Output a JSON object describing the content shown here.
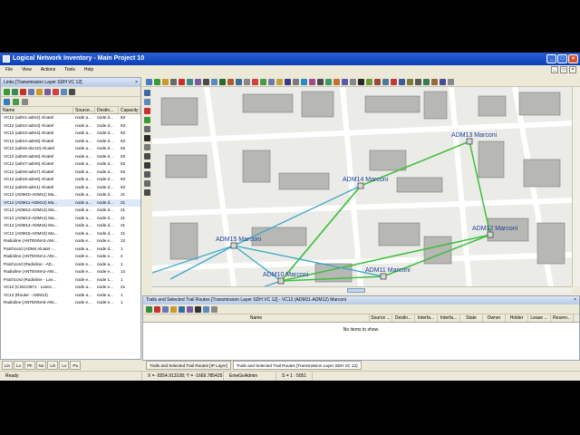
{
  "window": {
    "title": "Logical Network Inventory - Main Project 10"
  },
  "menu": [
    "File",
    "View",
    "Actions",
    "Tools",
    "Help"
  ],
  "links_panel": {
    "title": "Links [Transmission Layer SDH VC 12]",
    "columns": [
      "Name",
      "Source...",
      "Destin...",
      "Capacity"
    ],
    "rows": [
      [
        "VC12 (adm1-adm2) Alcatel",
        "node a...",
        "node d...",
        "63"
      ],
      [
        "VC12 (adm2-adm3) Alcatel",
        "node a...",
        "node d...",
        "63"
      ],
      [
        "VC12 (adm3-adm4) Alcatel",
        "node a...",
        "node d...",
        "63"
      ],
      [
        "VC12 (adm4-adm5) Alcatel",
        "node a...",
        "node d...",
        "63"
      ],
      [
        "VC12 (adm5-dxc10) Alcatel",
        "node a...",
        "node d...",
        "63"
      ],
      [
        "VC12 (adm5-adm6) Alcatel",
        "node a...",
        "node d...",
        "63"
      ],
      [
        "VC12 (adm7-adm6) Alcatel",
        "node a...",
        "node d...",
        "63"
      ],
      [
        "VC12 (adm8-adm7) Alcatel",
        "node a...",
        "node d...",
        "63"
      ],
      [
        "VC12 (adm9-adm8) Alcatel",
        "node a...",
        "node d...",
        "63"
      ],
      [
        "VC12 (adm9-adm1) Alcatel",
        "node a...",
        "node d...",
        "63"
      ],
      [
        "VC12 (ADM10-ADM11) Ma...",
        "node a...",
        "node d...",
        "21"
      ],
      [
        "VC12 (ADM11-ADM12) Ma...",
        "node a...",
        "node d...",
        "21"
      ],
      [
        "VC12 (ADM12-ADM13) Ma...",
        "node a...",
        "node d...",
        "21"
      ],
      [
        "VC12 (ADM13-ADM14) Ma...",
        "node a...",
        "node d...",
        "21"
      ],
      [
        "VC12 (ADM14-ADM15) Ma...",
        "node a...",
        "node d...",
        "21"
      ],
      [
        "VC12 (ADM15-ADM10) Ma...",
        "node a...",
        "node d...",
        "21"
      ],
      [
        "Radioline (ANTENNA3-ANI...",
        "node e...",
        "node e...",
        "12"
      ],
      [
        "Patchcord (ADM4 Alcatel -...",
        "node a...",
        "node d...",
        "1"
      ],
      [
        "Radioline (ANTENNA1-ANI...",
        "node e...",
        "node e...",
        "2"
      ],
      [
        "Patchcord (Radioline - AD...",
        "node e...",
        "node a...",
        "1"
      ],
      [
        "Radioline (ANTENNA2-ANI...",
        "node e...",
        "node e...",
        "12"
      ],
      [
        "Patchcord (Radioline - Lan...",
        "node e...",
        "node 1...",
        "1"
      ],
      [
        "VC12 (CISCO871 - Lanec...",
        "node a...",
        "node e...",
        "21"
      ],
      [
        "VC12 (Router - ADM13)",
        "node a...",
        "node a...",
        "1"
      ],
      [
        "Radioline (ANTENNA6-ANI...",
        "node e...",
        "node e...",
        "1"
      ]
    ],
    "tabs": [
      "Lin",
      "Lo",
      "Ph",
      "No",
      "Lin",
      "Lo",
      "Pa"
    ]
  },
  "map": {
    "nodes": [
      {
        "label": "ADM13 Marconi"
      },
      {
        "label": "ADM14 Marconi"
      },
      {
        "label": "ADM12 Marconi"
      },
      {
        "label": "ADM15 Marconi"
      },
      {
        "label": "ADM10 Marconi"
      },
      {
        "label": "ADM11 Marconi"
      }
    ]
  },
  "trails_panel": {
    "title": "Trails and Selected Trail Routes [Transmission Layer SDH VC 12] - VC12 (ADM11-ADM12) Marconi",
    "columns": [
      "Name",
      "Source ...",
      "Destin...",
      "Interfa...",
      "Interfa...",
      "State",
      "Owner",
      "Holder",
      "Lease ...",
      "Reserv..."
    ],
    "empty_message": "No items to show."
  },
  "bottom_tabs": [
    "Trails and Selected Trail Routes [IP Layer]",
    "Trails and Selected Trail Routes [Transmission Layer SDH VC 12]"
  ],
  "status": {
    "ready": "Ready",
    "coords": "X = -5554.913108; Y = -1669.785425",
    "user": "EmeGoAdmin",
    "scale": "S = 1 : 5051"
  },
  "colors": {
    "title_bar": "#0b3fb8",
    "trail_green": "#3fbf3f",
    "link_cyan": "#3aa8c8",
    "link_lightblue": "#8ec4e0"
  }
}
